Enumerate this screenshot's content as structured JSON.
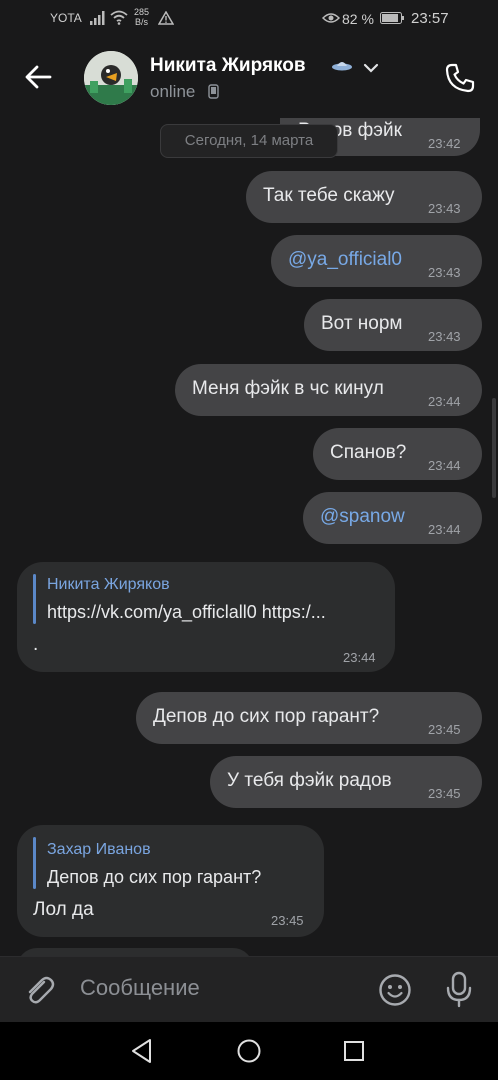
{
  "status_bar": {
    "carrier": "YOTA",
    "speed_value": "285",
    "speed_unit": "B/s",
    "battery": "82 %",
    "time": "23:57"
  },
  "header": {
    "contact_name": "Никита Жиряков",
    "status": "online",
    "icons": [
      "back-arrow-icon",
      "verified-ufo-icon",
      "chevron-down-icon",
      "phone-icon"
    ]
  },
  "chat": {
    "date_separator": "Сегодня, 14 марта",
    "messages": [
      {
        "direction": "out",
        "text": "Радов фэйк",
        "time": "23:42"
      },
      {
        "direction": "out",
        "text": "Так тебе скажу",
        "time": "23:43"
      },
      {
        "direction": "out",
        "text": "@ya_official0",
        "time": "23:43",
        "is_link": true
      },
      {
        "direction": "out",
        "text": "Вот норм",
        "time": "23:43"
      },
      {
        "direction": "out",
        "text": "Меня фэйк в чс кинул",
        "time": "23:44"
      },
      {
        "direction": "out",
        "text": "Спанов?",
        "time": "23:44"
      },
      {
        "direction": "out",
        "text": "@spanow",
        "time": "23:44",
        "is_link": true
      },
      {
        "direction": "in",
        "reply_author": "Никита Жиряков",
        "reply_text": "https://vk.com/ya_officlall0 https:/...",
        "text": ".",
        "time": "23:44"
      },
      {
        "direction": "out",
        "text": "Депов до сих пор гарант?",
        "time": "23:45"
      },
      {
        "direction": "out",
        "text": "У тебя фэйк радов",
        "time": "23:45"
      },
      {
        "direction": "in",
        "reply_author": "Захар Иванов",
        "reply_text": "Депов до сих пор гарант?",
        "text": "Лол да",
        "time": "23:45"
      }
    ]
  },
  "composer": {
    "placeholder": "Сообщение",
    "icons": [
      "paperclip-icon",
      "emoji-icon",
      "microphone-icon"
    ]
  },
  "navbar": {
    "icons": [
      "nav-back-icon",
      "nav-home-icon",
      "nav-recent-icon"
    ]
  },
  "colors": {
    "background": "#19191a",
    "bubble_out": "#444446",
    "bubble_in": "#2c2d2e",
    "link": "#78a9e6",
    "accent": "#5b88c8"
  }
}
